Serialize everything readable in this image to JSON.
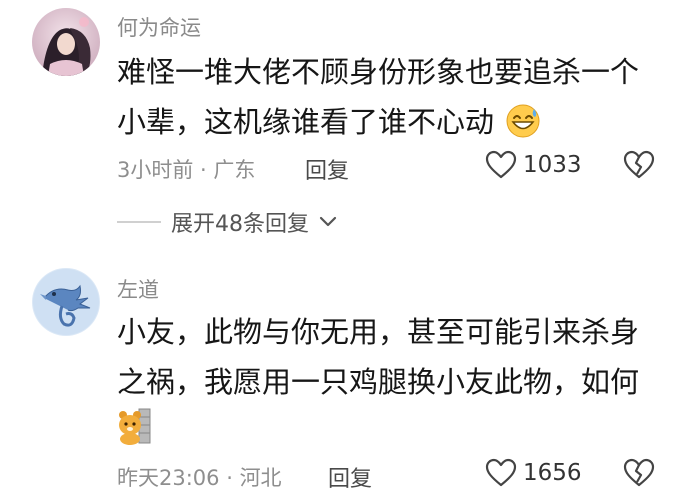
{
  "comments": [
    {
      "username": "何为命运",
      "text_line1": "难怪一堆大佬不顾身份形象也要追杀一个",
      "text_line2": "小辈，这机缘谁看了谁不心动",
      "time": "3小时前",
      "location": "广东",
      "reply_label": "回复",
      "likes": "1033",
      "expand_label": "展开48条回复"
    },
    {
      "username": "左道",
      "text_line1": "小友，此物与你无用，甚至可能引来杀身",
      "text_line2": "之祸，我愿用一只鸡腿换小友此物，如何",
      "time": "昨天23:06",
      "location": "河北",
      "reply_label": "回复",
      "likes": "1656"
    }
  ],
  "separator": " · ",
  "icons": {
    "like": "heart-outline-icon",
    "dislike": "broken-heart-icon",
    "expand": "chevron-down-icon",
    "emoji1": "grinning-sweat-emoji",
    "emoji2": "bear-sticker-emoji"
  }
}
